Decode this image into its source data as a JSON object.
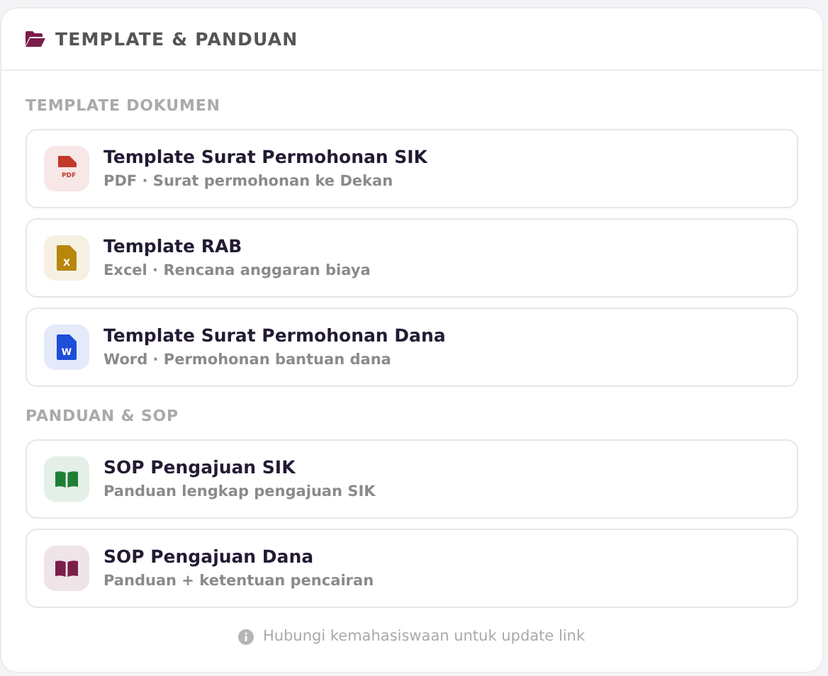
{
  "header": {
    "title": "TEMPLATE & PANDUAN"
  },
  "sections": [
    {
      "title": "TEMPLATE DOKUMEN",
      "items": [
        {
          "kind": "pdf",
          "color": "#c0392b",
          "badge": "PDF",
          "title": "Template Surat Permohonan SIK",
          "subtitle": "PDF · Surat permohonan ke Dekan"
        },
        {
          "kind": "excel",
          "color": "#b8860b",
          "badge": "X",
          "title": "Template RAB",
          "subtitle": "Excel · Rencana anggaran biaya"
        },
        {
          "kind": "word",
          "color": "#1d4ed8",
          "badge": "W",
          "title": "Template Surat Permohonan Dana",
          "subtitle": "Word · Permohonan bantuan dana"
        }
      ]
    },
    {
      "title": "PANDUAN & SOP",
      "items": [
        {
          "kind": "book",
          "color": "#1e7e34",
          "title": "SOP Pengajuan SIK",
          "subtitle": "Panduan lengkap pengajuan SIK"
        },
        {
          "kind": "book",
          "color": "#7a1e4a",
          "title": "SOP Pengajuan Dana",
          "subtitle": "Panduan + ketentuan pencairan"
        }
      ]
    }
  ],
  "footer": {
    "note": "Hubungi kemahasiswaan untuk update link"
  }
}
